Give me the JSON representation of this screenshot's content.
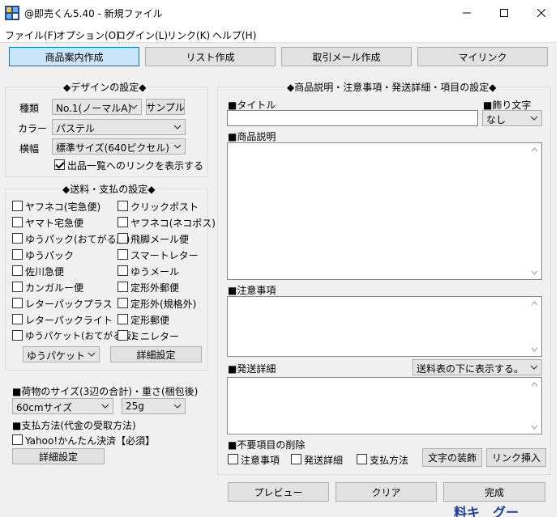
{
  "window": {
    "title": "@即売くん5.40 - 新規ファイル",
    "minimize_icon": "minimize-icon",
    "maximize_icon": "maximize-icon",
    "close_icon": "close-icon"
  },
  "menu": [
    "ファイル(F)",
    "オプション(O)",
    "ログイン(L)",
    "リンク(K)",
    "ヘルプ(H)"
  ],
  "tabs": [
    "商品案内作成",
    "リスト作成",
    "取引メール作成",
    "マイリンク"
  ],
  "design": {
    "title": "◆デザインの設定◆",
    "type_label": "種類",
    "type_value": "No.1(ノーマルA)",
    "sample_button": "サンプル",
    "color_label": "カラー",
    "color_value": "パステル",
    "width_label": "横幅",
    "width_value": "標準サイズ(640ピクセル)",
    "link_checkbox_label": "出品一覧へのリンクを表示する",
    "link_checked": true
  },
  "shipping": {
    "title": "◆送料・支払の設定◆",
    "left": [
      "ヤフネコ(宅急便)",
      "ヤマト宅急便",
      "ゆうパック(おてがる版)",
      "ゆうパック",
      "佐川急便",
      "カンガルー便",
      "レターパックプラス",
      "レターパックライト",
      "ゆうパケット(おてがる版)"
    ],
    "right": [
      "クリックポスト",
      "ヤフネコ(ネコポス)",
      "飛脚メール便",
      "スマートレター",
      "ゆうメール",
      "定形外郵便",
      "定形外(規格外)",
      "定形郵便",
      "ミニレター"
    ],
    "method_value": "ゆうパケット",
    "detail_button": "詳細設定",
    "size_title": "■荷物のサイズ(3辺の合計)・重さ(梱包後)",
    "size_value": "60cmサイズ",
    "weight_value": "25g",
    "payment_title": "■支払方法(代金の受取方法)",
    "payment_checkbox": "Yahoo!かんたん決済【必須】",
    "payment_detail_button": "詳細設定"
  },
  "item": {
    "title": "◆商品説明・注意事項・発送詳細・項目の設定◆",
    "title_label": "■タイトル",
    "title_value": "",
    "decor_label": "■飾り文字",
    "decor_value": "なし",
    "desc_label": "■商品説明",
    "notes_label": "■注意事項",
    "ship_label": "■発送詳細",
    "ship_position_value": "送料表の下に表示する。",
    "remove_label": "■不要項目の削除",
    "remove_items": [
      "注意事項",
      "発送詳細",
      "支払方法"
    ],
    "decorate_button": "文字の装飾",
    "insert_link_button": "リンク挿入"
  },
  "footer": {
    "preview": "プレビュー",
    "clear": "クリア",
    "done": "完成"
  },
  "background_partial_text": "料キ　グー"
}
